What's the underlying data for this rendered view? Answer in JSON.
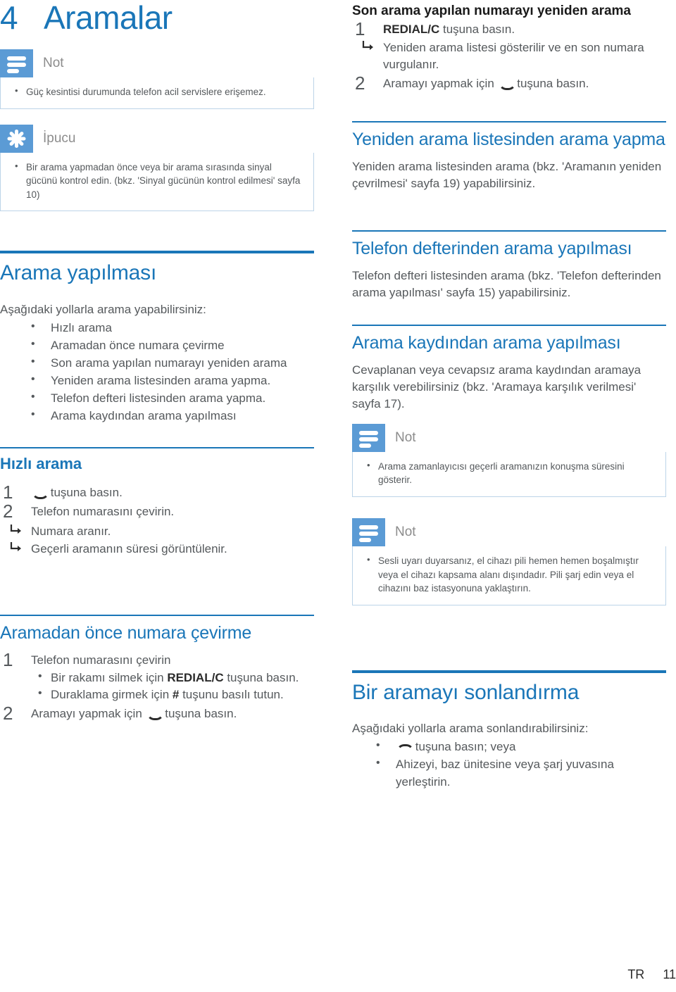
{
  "colors": {
    "brand_blue": "#1a76b8",
    "icon_blue": "#5b9bd5",
    "body_gray": "#55595c",
    "note_label_gray": "#8c8c8c"
  },
  "chapter": {
    "number": "4",
    "title": "Aramalar"
  },
  "left_column": {
    "note_box": {
      "label": "Not",
      "items": [
        "Güç kesintisi durumunda telefon acil servislere erişemez."
      ]
    },
    "tip_box": {
      "label": "İpucu",
      "items": [
        "Bir arama yapmadan önce veya bir arama sırasında sinyal gücünü kontrol edin. (bkz. 'Sinyal gücünün kontrol edilmesi' sayfa 10)"
      ]
    },
    "section_arama_yapilmasi": {
      "heading": "Arama yapılması",
      "intro": "Aşağıdaki yollarla arama yapabilirsiniz:",
      "bullets": [
        "Hızlı arama",
        "Aramadan önce numara çevirme",
        "Son arama yapılan numarayı yeniden arama",
        "Yeniden arama listesinden arama yapma.",
        "Telefon defteri listesinden arama yapma.",
        "Arama kaydından arama yapılması"
      ]
    },
    "section_hizli_arama": {
      "heading": "Hızlı arama",
      "step1_prefix": "",
      "step1_suffix": " tuşuna basın.",
      "step1_icon": "call-key-icon",
      "step2": "Telefon numarasını çevirin.",
      "results": [
        "Numara aranır.",
        "Geçerli aramanın süresi görüntülenir."
      ]
    },
    "section_aramadan_once": {
      "heading": "Aramadan önce numara çevirme",
      "step1": "Telefon numarasını çevirin",
      "step1_bullets": [
        {
          "before": "Bir rakamı silmek için ",
          "bold": "REDIAL/C",
          "after": " tuşuna basın."
        },
        {
          "before": "Duraklama girmek için ",
          "bold": "#",
          "after": " tuşunu basılı tutun."
        }
      ],
      "step2_prefix": "Aramayı yapmak için ",
      "step2_suffix": " tuşuna basın.",
      "step2_icon": "call-key-icon"
    }
  },
  "right_column": {
    "section_son_arama": {
      "heading": "Son arama yapılan numarayı yeniden arama",
      "step1_bold": "REDIAL/C",
      "step1_rest": " tuşuna basın.",
      "step1_results": [
        "Yeniden arama listesi gösterilir ve en son numara vurgulanır."
      ],
      "step2_prefix": "Aramayı yapmak için ",
      "step2_suffix": " tuşuna basın.",
      "step2_icon": "call-key-icon"
    },
    "section_yeniden_arama": {
      "heading": "Yeniden arama listesinden arama yapma",
      "body": "Yeniden arama listesinden arama (bkz. 'Aramanın yeniden çevrilmesi' sayfa 19) yapabilirsiniz."
    },
    "section_telefon_defteri": {
      "heading": "Telefon defterinden arama yapılması",
      "body": "Telefon defteri listesinden arama (bkz. 'Telefon defterinden arama yapılması' sayfa 15) yapabilirsiniz."
    },
    "section_arama_kaydi": {
      "heading": "Arama kaydından arama yapılması",
      "body": "Cevaplanan veya cevapsız arama kaydından aramaya karşılık verebilirsiniz (bkz. 'Aramaya karşılık verilmesi' sayfa 17)."
    },
    "note_box_1": {
      "label": "Not",
      "items": [
        "Arama zamanlayıcısı geçerli aramanızın konuşma süresini gösterir."
      ]
    },
    "note_box_2": {
      "label": "Not",
      "items": [
        "Sesli uyarı duyarsanız, el cihazı pili hemen hemen boşalmıştır veya el cihazı kapsama alanı dışındadır. Pili şarj edin veya el cihazını baz istasyonuna yaklaştırın."
      ]
    },
    "section_sonlandirma": {
      "heading": "Bir aramayı sonlandırma",
      "intro": "Aşağıdaki yollarla arama sonlandırabilirsiniz:",
      "bullet1_suffix": " tuşuna basın; veya",
      "bullet1_icon": "end-call-key-icon",
      "bullet2": "Ahizeyi, baz ünitesine veya şarj yuvasına yerleştirin."
    }
  },
  "footer": {
    "language": "TR",
    "page_number": "11"
  }
}
